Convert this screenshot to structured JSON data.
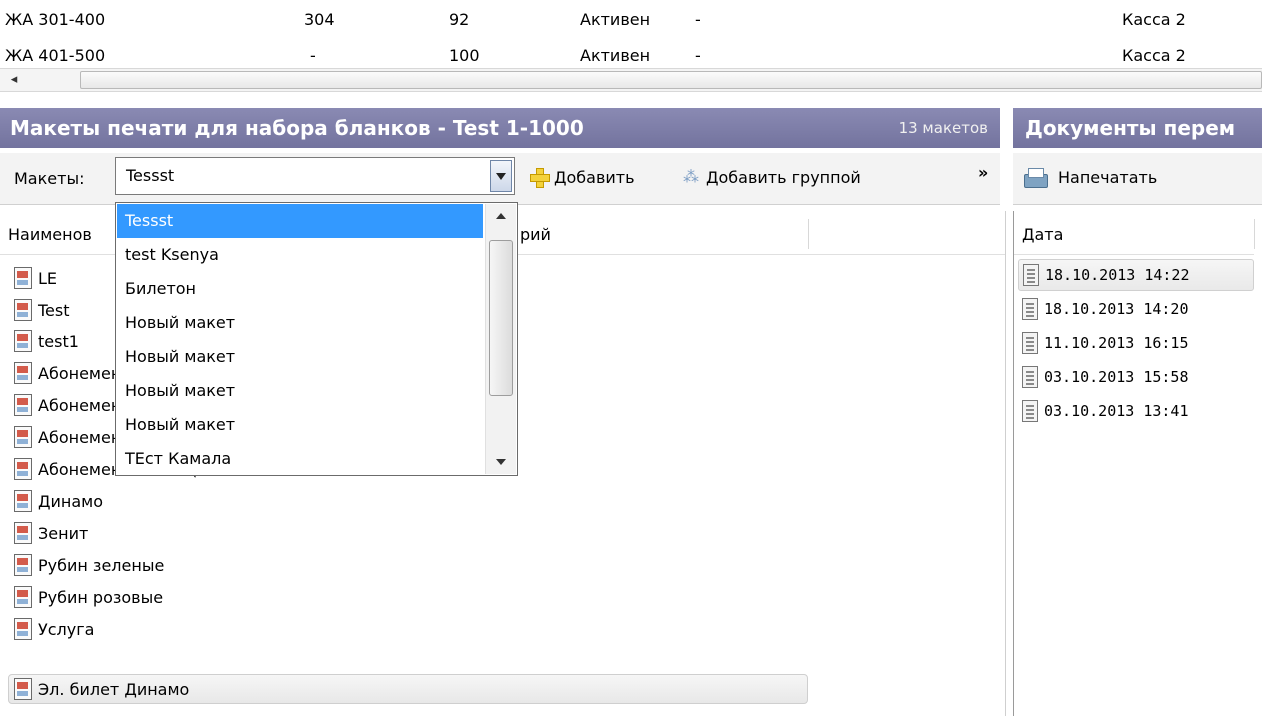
{
  "top_table": {
    "rows": [
      {
        "name": "ЖА 301-400",
        "col2": "304",
        "col3": "92",
        "status": "Активен",
        "col5": "-",
        "cash": "Касса 2"
      },
      {
        "name": "ЖА 401-500",
        "col2": "-",
        "col3": "100",
        "status": "Активен",
        "col5": "-",
        "cash": "Касса 2"
      }
    ],
    "scroll_left_arrow": "◂"
  },
  "left_panel": {
    "title": "Макеты печати для набора бланков - Test 1-1000",
    "count": "13 макетов",
    "toolbar": {
      "label": "Макеты:",
      "combo_value": "Tessst",
      "add_label": "Добавить",
      "add_group_label": "Добавить группой",
      "more": "»"
    },
    "columns": [
      "Наименование",
      "Комментарий"
    ],
    "column_visible": [
      "Наименов",
      "рий"
    ],
    "items": [
      "LE",
      "Test",
      "test1",
      "Абонемент",
      "Абонемент",
      "Абонемент",
      "Абонемент Зенит (внешние кас...",
      "Динамо",
      "Зенит",
      "Рубин зеленые",
      "Рубин розовые",
      "Услуга",
      "Эл. билет Динамо"
    ]
  },
  "dropdown": {
    "options": [
      "Tessst",
      "test Ksenya",
      "Билетон",
      "Новый макет",
      "Новый макет",
      "Новый макет",
      "Новый макет",
      "ТЕст Камала"
    ],
    "selected_index": 0
  },
  "right_panel": {
    "title": "Документы перем",
    "print_label": "Напечатать",
    "column": "Дата",
    "dates": [
      "18.10.2013 14:22",
      "18.10.2013 14:20",
      "11.10.2013 16:15",
      "03.10.2013 15:58",
      "03.10.2013 13:41"
    ]
  },
  "colors": {
    "header_bg": "#7f7fab",
    "selection": "#3399ff"
  }
}
